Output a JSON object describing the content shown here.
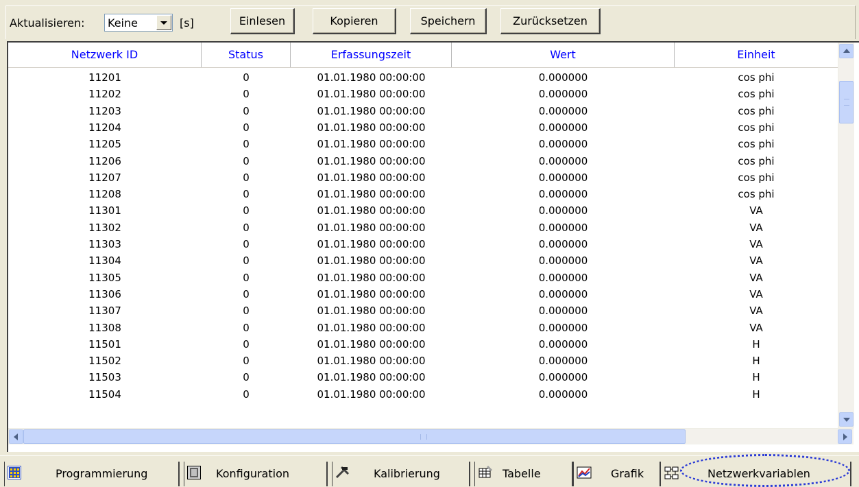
{
  "toolbar": {
    "refresh_label": "Aktualisieren:",
    "refresh_value": "Keine",
    "unit_label": "[s]",
    "buttons": [
      "Einlesen",
      "Kopieren",
      "Speichern",
      "Zurücksetzen"
    ]
  },
  "table": {
    "columns": [
      "Netzwerk ID",
      "Status",
      "Erfassungszeit",
      "Wert",
      "Einheit"
    ],
    "rows": [
      [
        "11201",
        "0",
        "01.01.1980 00:00:00",
        "0.000000",
        "cos phi"
      ],
      [
        "11202",
        "0",
        "01.01.1980 00:00:00",
        "0.000000",
        "cos phi"
      ],
      [
        "11203",
        "0",
        "01.01.1980 00:00:00",
        "0.000000",
        "cos phi"
      ],
      [
        "11204",
        "0",
        "01.01.1980 00:00:00",
        "0.000000",
        "cos phi"
      ],
      [
        "11205",
        "0",
        "01.01.1980 00:00:00",
        "0.000000",
        "cos phi"
      ],
      [
        "11206",
        "0",
        "01.01.1980 00:00:00",
        "0.000000",
        "cos phi"
      ],
      [
        "11207",
        "0",
        "01.01.1980 00:00:00",
        "0.000000",
        "cos phi"
      ],
      [
        "11208",
        "0",
        "01.01.1980 00:00:00",
        "0.000000",
        "cos phi"
      ],
      [
        "11301",
        "0",
        "01.01.1980 00:00:00",
        "0.000000",
        "VA"
      ],
      [
        "11302",
        "0",
        "01.01.1980 00:00:00",
        "0.000000",
        "VA"
      ],
      [
        "11303",
        "0",
        "01.01.1980 00:00:00",
        "0.000000",
        "VA"
      ],
      [
        "11304",
        "0",
        "01.01.1980 00:00:00",
        "0.000000",
        "VA"
      ],
      [
        "11305",
        "0",
        "01.01.1980 00:00:00",
        "0.000000",
        "VA"
      ],
      [
        "11306",
        "0",
        "01.01.1980 00:00:00",
        "0.000000",
        "VA"
      ],
      [
        "11307",
        "0",
        "01.01.1980 00:00:00",
        "0.000000",
        "VA"
      ],
      [
        "11308",
        "0",
        "01.01.1980 00:00:00",
        "0.000000",
        "VA"
      ],
      [
        "11501",
        "0",
        "01.01.1980 00:00:00",
        "0.000000",
        "H"
      ],
      [
        "11502",
        "0",
        "01.01.1980 00:00:00",
        "0.000000",
        "H"
      ],
      [
        "11503",
        "0",
        "01.01.1980 00:00:00",
        "0.000000",
        "H"
      ],
      [
        "11504",
        "0",
        "01.01.1980 00:00:00",
        "0.000000",
        "H"
      ]
    ]
  },
  "tabs": [
    {
      "label": "Programmierung",
      "icon": "grid-icon"
    },
    {
      "label": "Konfiguration",
      "icon": "device-icon"
    },
    {
      "label": "Kalibrierung",
      "icon": "tools-icon"
    },
    {
      "label": "Tabelle",
      "icon": "table-icon"
    },
    {
      "label": "Grafik",
      "icon": "chart-icon"
    },
    {
      "label": "Netzwerkvariablen",
      "icon": "network-icon",
      "active": true
    }
  ],
  "colors": {
    "header_text": "#0000ff",
    "scrollbar": "#c1d3fb",
    "highlight_ring": "#2b3bd6"
  }
}
